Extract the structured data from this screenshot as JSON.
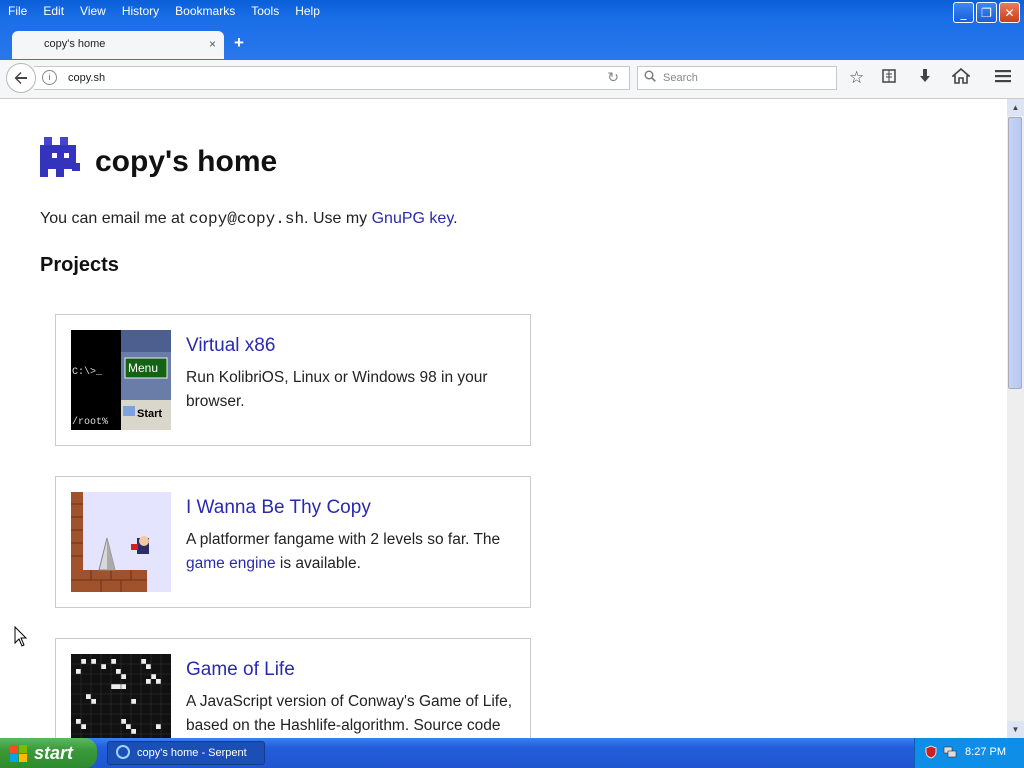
{
  "menubar": {
    "items": [
      "File",
      "Edit",
      "View",
      "History",
      "Bookmarks",
      "Tools",
      "Help"
    ]
  },
  "tab": {
    "title": "copy's home",
    "close": "×",
    "new": "+"
  },
  "navbar": {
    "url": "copy.sh",
    "search_placeholder": "Search"
  },
  "page": {
    "title": "copy's home",
    "intro_prefix": "You can email me at ",
    "email": "copy@copy.sh",
    "intro_middle": ". Use my ",
    "gnupg_link": "GnuPG key",
    "intro_suffix": ".",
    "projects_heading": "Projects",
    "projects": [
      {
        "title": "Virtual x86",
        "desc": "Run KolibriOS, Linux or Windows 98 in your browser.",
        "thumb": {
          "prompt1": "C:\\>_",
          "menu": "Menu",
          "prompt2": "/root%",
          "start": "Start"
        }
      },
      {
        "title": "I Wanna Be Thy Copy",
        "desc_prefix": "A platformer fangame with 2 levels so far. The ",
        "desc_link": "game engine",
        "desc_suffix": " is available."
      },
      {
        "title": "Game of Life",
        "desc": "A JavaScript version of Conway's Game of Life, based on the Hashlife-algorithm. Source code"
      }
    ]
  },
  "taskbar": {
    "start": "start",
    "window": "copy's home - Serpent",
    "time": "8:27 PM"
  },
  "colors": {
    "link": "#2a2ab0",
    "titlebar": "#0a5fd8",
    "taskbar": "#245edb",
    "start": "#3a9a3a"
  }
}
